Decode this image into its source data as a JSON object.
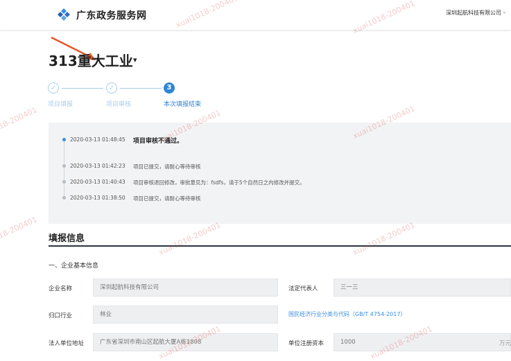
{
  "header": {
    "site_name": "广东政务服务网",
    "user_name": "深圳起航科技有限公司",
    "user_caret": "⌄"
  },
  "project": {
    "title": "313重大工业",
    "caret": "▾"
  },
  "steps": [
    {
      "label": "项目填报",
      "state": "done",
      "mark": "✓"
    },
    {
      "label": "项目审核",
      "state": "done",
      "mark": "✓"
    },
    {
      "label": "本次填报结束",
      "state": "active",
      "mark": "3"
    }
  ],
  "timeline": [
    {
      "time": "2020-03-13 01:48:45",
      "message": "项目审核不通过。"
    },
    {
      "time": "2020-03-13 01:42:23",
      "message": "项目已提交，请耐心等待审核"
    },
    {
      "time": "2020-03-13 01:40:43",
      "message": "项目审核退回修改，审批意见为：fsdfs，请于5个自然日之内修改并提交。"
    },
    {
      "time": "2020-03-13 01:38:50",
      "message": "项目已提交，请耐心等待审核"
    }
  ],
  "section": {
    "title": "填报信息",
    "subsection": "一、企业基本信息"
  },
  "form": {
    "company_name_label": "企业名称",
    "company_name_value": "深圳起航科技有限公司",
    "legal_rep_label": "法定代表人",
    "legal_rep_value": "三一三",
    "industry_label": "归口行业",
    "industry_value": "林业",
    "industry_link": "国民经济行业分类与代码（GB/T 4754-2017）",
    "address_label": "法人单位地址",
    "address_value": "广东省深圳市南山区起航大厦A栋1808",
    "capital_label": "单位注册资本",
    "capital_value": "1000",
    "capital_unit": "万元"
  },
  "watermark": "xuai1018-200401",
  "colors": {
    "accent": "#2f86d4",
    "step_done": "#a9cdea",
    "timeline_bg": "#f2f3f5",
    "field_bg": "#eeeff1",
    "arrow": "#e8542a"
  }
}
